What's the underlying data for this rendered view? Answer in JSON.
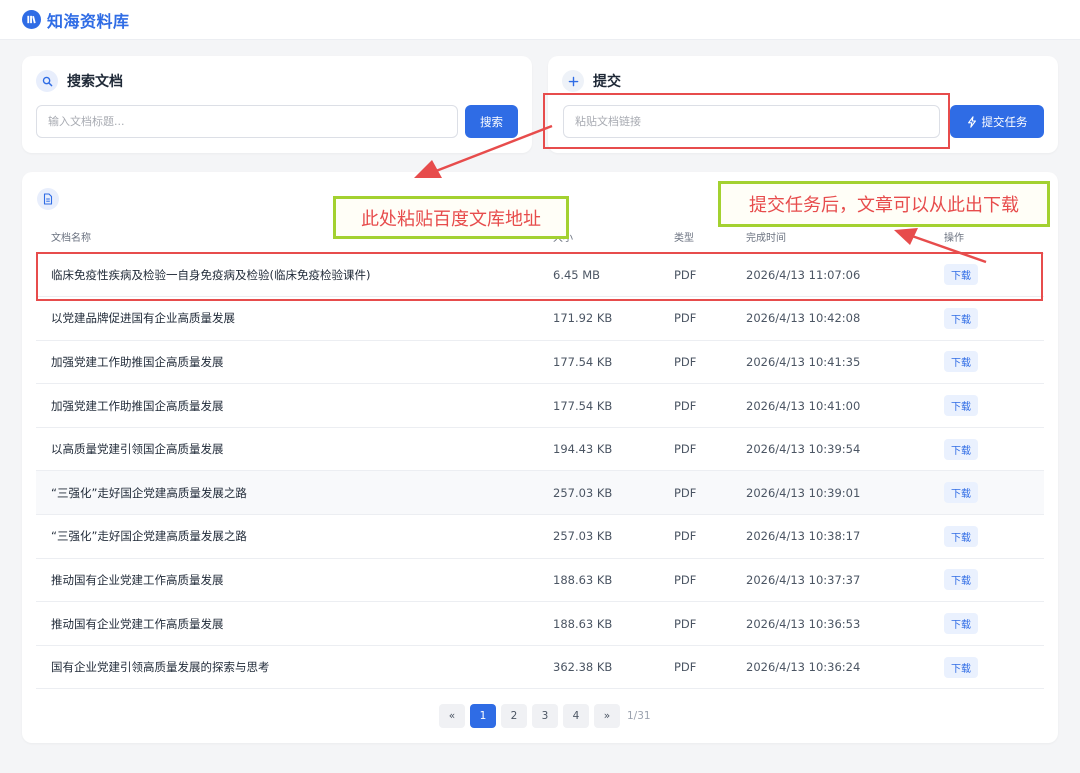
{
  "app": {
    "title": "知海资料库"
  },
  "search": {
    "title": "搜索文档",
    "placeholder": "输入文档标题...",
    "button": "搜索"
  },
  "submit": {
    "title": "提交",
    "placeholder": "粘贴文档链接",
    "button": "提交任务"
  },
  "table": {
    "headers": {
      "name": "文档名称",
      "size": "大小",
      "type": "类型",
      "time": "完成时间",
      "action": "操作"
    },
    "action_label": "下载",
    "rows": [
      {
        "name": "临床免疫性疾病及检验一自身免疫病及检验(临床免疫检验课件)",
        "size": "6.45 MB",
        "type": "PDF",
        "time": "2026/4/13 11:07:06"
      },
      {
        "name": "以党建品牌促进国有企业高质量发展",
        "size": "171.92 KB",
        "type": "PDF",
        "time": "2026/4/13 10:42:08"
      },
      {
        "name": "加强党建工作助推国企高质量发展",
        "size": "177.54 KB",
        "type": "PDF",
        "time": "2026/4/13 10:41:35"
      },
      {
        "name": "加强党建工作助推国企高质量发展",
        "size": "177.54 KB",
        "type": "PDF",
        "time": "2026/4/13 10:41:00"
      },
      {
        "name": "以高质量党建引领国企高质量发展",
        "size": "194.43 KB",
        "type": "PDF",
        "time": "2026/4/13 10:39:54"
      },
      {
        "name": "“三强化”走好国企党建高质量发展之路",
        "size": "257.03 KB",
        "type": "PDF",
        "time": "2026/4/13 10:39:01"
      },
      {
        "name": "“三强化”走好国企党建高质量发展之路",
        "size": "257.03 KB",
        "type": "PDF",
        "time": "2026/4/13 10:38:17"
      },
      {
        "name": "推动国有企业党建工作高质量发展",
        "size": "188.63 KB",
        "type": "PDF",
        "time": "2026/4/13 10:37:37"
      },
      {
        "name": "推动国有企业党建工作高质量发展",
        "size": "188.63 KB",
        "type": "PDF",
        "time": "2026/4/13 10:36:53"
      },
      {
        "name": "国有企业党建引领高质量发展的探索与思考",
        "size": "362.38 KB",
        "type": "PDF",
        "time": "2026/4/13 10:36:24"
      }
    ]
  },
  "pagination": {
    "prev": "«",
    "pages": [
      "1",
      "2",
      "3",
      "4"
    ],
    "next": "»",
    "info": "1/31",
    "current": "1"
  },
  "annotations": {
    "paste_hint": "此处粘贴百度文库地址",
    "download_hint": "提交任务后，文章可以从此出下载"
  },
  "colors": {
    "accent": "#2f6ce5",
    "annotation_red": "#e74c4c",
    "annotation_green": "#a3d130"
  }
}
